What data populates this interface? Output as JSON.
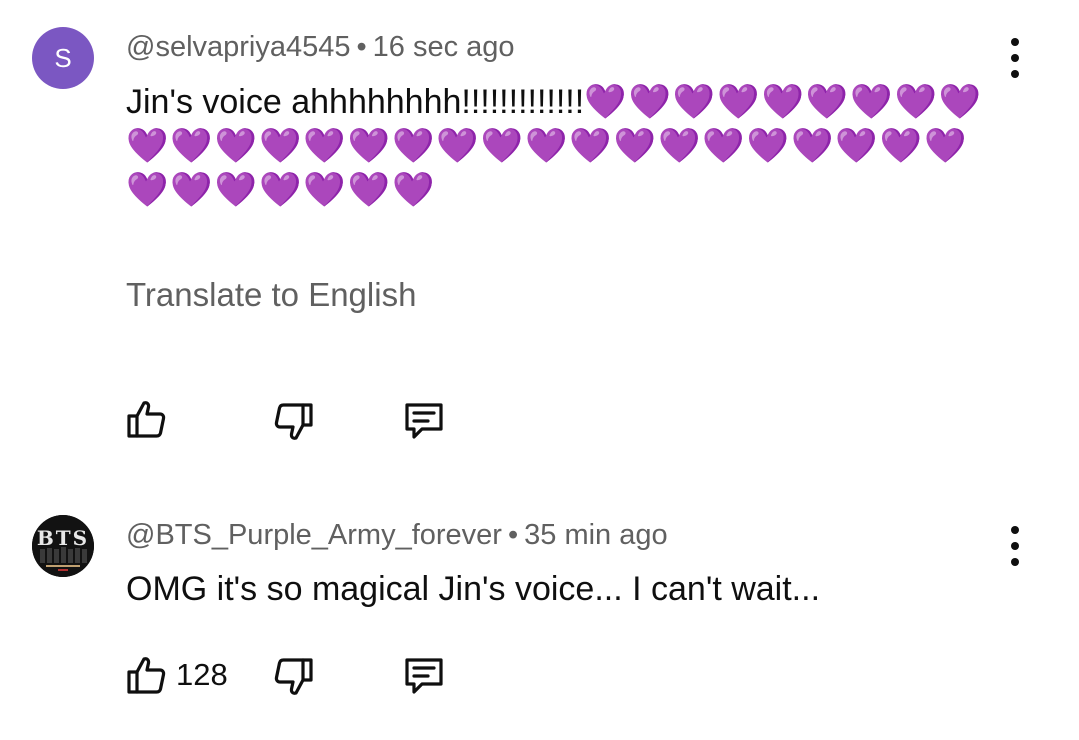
{
  "comments": [
    {
      "author": "@selvapriya4545",
      "separator": "•",
      "time": "16 sec ago",
      "avatar_letter": "S",
      "avatar_color": "#7b57c2",
      "text": "Jin's voice ahhhhhhhh!!!!!!!!!!!!!",
      "hearts": "💜💜💜💜💜💜💜💜💜💜💜💜💜💜💜💜💜💜💜💜💜💜💜💜💜💜💜💜💜💜💜💜💜💜💜",
      "translate_label": "Translate to English",
      "like_count": ""
    },
    {
      "author": "@BTS_Purple_Army_forever",
      "separator": "•",
      "time": "35 min ago",
      "avatar_text": "BTS",
      "text": "OMG it's so magical Jin's voice... I can't wait...",
      "like_count": "128"
    }
  ],
  "colors": {
    "heart": "#9b3cf0",
    "secondary_text": "#606060",
    "primary_text": "#0f0f0f"
  },
  "icons": [
    "like-icon",
    "dislike-icon",
    "reply-icon",
    "more-vert-icon"
  ]
}
